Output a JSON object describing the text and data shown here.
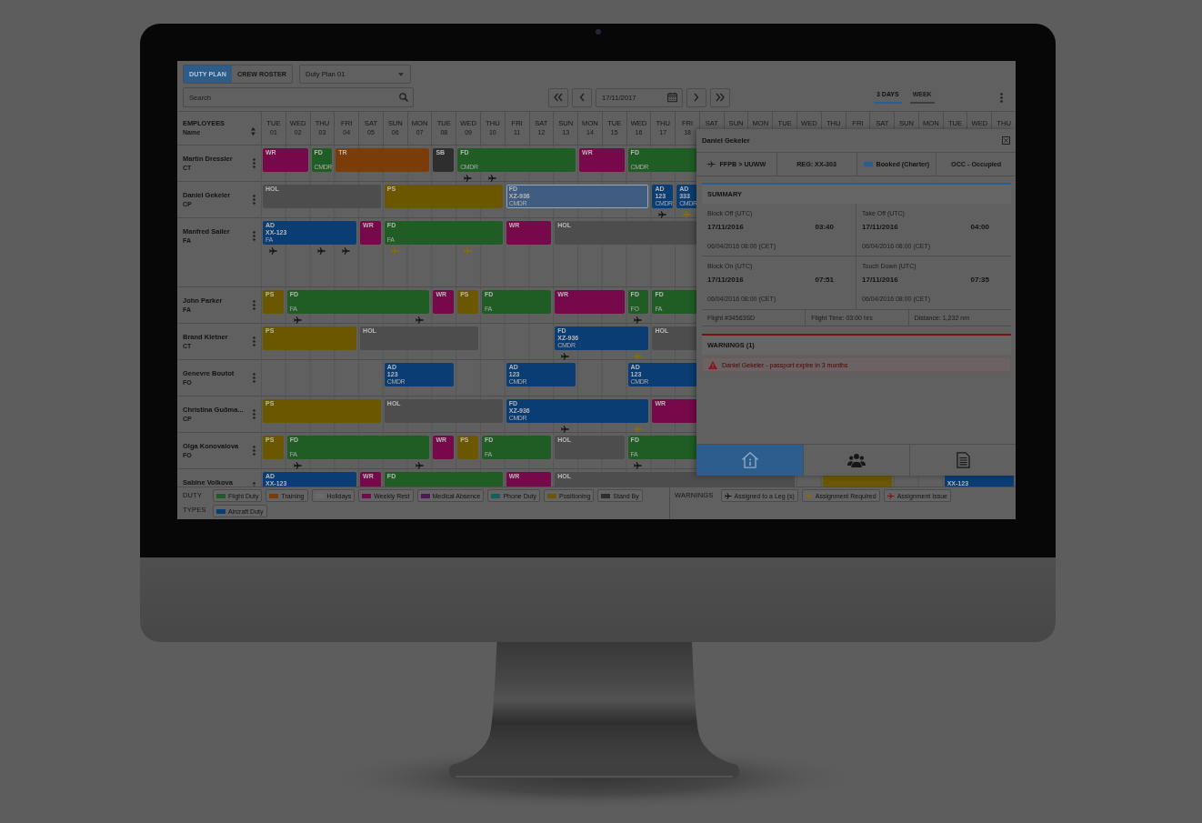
{
  "toolbar": {
    "view_switch": [
      {
        "label": "DUTY PLAN",
        "selected": true
      },
      {
        "label": "CREW ROSTER",
        "selected": false
      }
    ],
    "plan_select": {
      "value": "Duty Plan 01"
    },
    "search": {
      "placeholder": "Search"
    },
    "date_field": {
      "value": "17/11/2017"
    },
    "range_tabs": [
      {
        "label": "3 DAYS",
        "selected": true
      },
      {
        "label": "WEEK",
        "selected": false
      }
    ]
  },
  "schedule": {
    "employees_header": {
      "title": "EMPLOYEES",
      "subtitle": "Name"
    },
    "days": [
      {
        "day": "TUE",
        "date": "01"
      },
      {
        "day": "WED",
        "date": "02"
      },
      {
        "day": "THU",
        "date": "03"
      },
      {
        "day": "FRI",
        "date": "04"
      },
      {
        "day": "SAT",
        "date": "05"
      },
      {
        "day": "SUN",
        "date": "06"
      },
      {
        "day": "MON",
        "date": "07"
      },
      {
        "day": "TUE",
        "date": "08"
      },
      {
        "day": "WED",
        "date": "09"
      },
      {
        "day": "THU",
        "date": "10"
      },
      {
        "day": "FRI",
        "date": "11"
      },
      {
        "day": "SAT",
        "date": "12"
      },
      {
        "day": "SUN",
        "date": "13"
      },
      {
        "day": "MON",
        "date": "14"
      },
      {
        "day": "TUE",
        "date": "15"
      },
      {
        "day": "WED",
        "date": "16"
      },
      {
        "day": "THU",
        "date": "17"
      },
      {
        "day": "FRI",
        "date": "18"
      },
      {
        "day": "SAT"
      },
      {
        "day": "SUN"
      },
      {
        "day": "MON"
      },
      {
        "day": "TUE"
      },
      {
        "day": "WED"
      },
      {
        "day": "THU"
      },
      {
        "day": "FRI"
      },
      {
        "day": "SAT"
      },
      {
        "day": "SUN"
      },
      {
        "day": "MON"
      },
      {
        "day": "TUE"
      },
      {
        "day": "WED"
      },
      {
        "day": "THU"
      }
    ],
    "rows": [
      {
        "name": "Martin Dressler",
        "role": "CT",
        "expanded": false,
        "timeline": [
          {
            "kind": "duty",
            "code": "WR",
            "color": "#76094a",
            "selected": false
          },
          {
            "kind": "continued"
          },
          {
            "kind": "duty",
            "code": "FD",
            "role": "CMDR",
            "color": "#1f5d24",
            "selected": false
          },
          {
            "kind": "duty",
            "code": "TR",
            "color": "#7a3c08",
            "selected": false
          },
          {
            "kind": "continued"
          },
          {
            "kind": "continued"
          },
          {
            "kind": "continued"
          },
          {
            "kind": "duty",
            "code": "SB",
            "color": "#2e2e2e",
            "selected": false
          },
          {
            "kind": "duty",
            "code": "FD",
            "role": "CMDR",
            "color": "#1f5d24",
            "selected": false,
            "marker": {
              "color": "#121212"
            }
          },
          {
            "kind": "continued",
            "marker": {
              "color": "#121212"
            }
          },
          {
            "kind": "continued"
          },
          {
            "kind": "continued"
          },
          {
            "kind": "continued"
          },
          {
            "kind": "duty",
            "code": "WR",
            "color": "#76094a",
            "selected": false
          },
          {
            "kind": "continued"
          },
          {
            "kind": "duty",
            "code": "FD",
            "role": "CMDR",
            "color": "#1f5d24",
            "selected": false
          },
          {
            "kind": "continued"
          },
          {
            "kind": "continued"
          }
        ]
      },
      {
        "name": "Daniel Gekeler",
        "role": "CP",
        "expanded": false,
        "timeline": [
          {
            "kind": "duty",
            "code": "HOL",
            "color": "#4d4d4d",
            "selected": false
          },
          {
            "kind": "continued"
          },
          {
            "kind": "continued"
          },
          {
            "kind": "continued"
          },
          {
            "kind": "continued"
          },
          {
            "kind": "duty",
            "code": "PS",
            "color": "#6b5700",
            "selected": false
          },
          {
            "kind": "continued"
          },
          {
            "kind": "continued"
          },
          {
            "kind": "continued"
          },
          {
            "kind": "continued"
          },
          {
            "kind": "duty",
            "code": "FD",
            "detail": "XZ-936",
            "role": "CMDR",
            "color": "#405d80",
            "selected": true
          },
          {
            "kind": "continued"
          },
          {
            "kind": "continued"
          },
          {
            "kind": "continued"
          },
          {
            "kind": "continued"
          },
          {
            "kind": "continued"
          },
          {
            "kind": "duty",
            "code": "AD",
            "detail": "123",
            "role": "CMDR",
            "color": "#0a3d73",
            "selected": false,
            "marker": {
              "color": "#121212"
            }
          },
          {
            "kind": "duty",
            "code": "AD",
            "detail": "333",
            "role": "CMDR",
            "color": "#0a3d73",
            "selected": false,
            "marker": {
              "color": "#8a7000"
            }
          }
        ]
      },
      {
        "name": "Manfred Sailer",
        "role": "FA",
        "expanded": true,
        "timeline": [
          {
            "kind": "duty",
            "code": "AD",
            "detail": "XX-123",
            "role": "FA",
            "color": "#0a3d73",
            "selected": false,
            "marker": {
              "color": "#121212"
            }
          },
          {
            "kind": "continued"
          },
          {
            "kind": "continued",
            "marker": {
              "color": "#121212"
            }
          },
          {
            "kind": "continued",
            "marker": {
              "color": "#121212"
            }
          },
          {
            "kind": "duty",
            "code": "WR",
            "color": "#76094a",
            "selected": false
          },
          {
            "kind": "duty",
            "code": "FD",
            "role": "FA",
            "color": "#1f5d24",
            "selected": false,
            "marker": {
              "color": "#8a7000"
            }
          },
          {
            "kind": "continued"
          },
          {
            "kind": "continued"
          },
          {
            "kind": "continued",
            "marker": {
              "color": "#8a7000"
            }
          },
          {
            "kind": "continued"
          },
          {
            "kind": "duty",
            "code": "WR",
            "color": "#76094a",
            "selected": false
          },
          {
            "kind": "continued"
          },
          {
            "kind": "duty",
            "code": "HOL",
            "color": "#4d4d4d",
            "selected": false
          },
          {
            "kind": "continued"
          },
          {
            "kind": "continued"
          },
          {
            "kind": "continued"
          },
          {
            "kind": "continued"
          },
          {
            "kind": "continued"
          }
        ]
      },
      {
        "name": "John Parker",
        "role": "FA",
        "expanded": false,
        "timeline": [
          {
            "kind": "duty",
            "code": "PS",
            "color": "#6b5700",
            "selected": false
          },
          {
            "kind": "duty",
            "code": "FD",
            "role": "FA",
            "color": "#1f5d24",
            "selected": false,
            "marker": {
              "color": "#121212"
            }
          },
          {
            "kind": "continued"
          },
          {
            "kind": "continued"
          },
          {
            "kind": "continued"
          },
          {
            "kind": "continued"
          },
          {
            "kind": "continued",
            "marker": {
              "color": "#121212"
            }
          },
          {
            "kind": "duty",
            "code": "WR",
            "color": "#76094a",
            "selected": false
          },
          {
            "kind": "duty",
            "code": "PS",
            "color": "#6b5700",
            "selected": false
          },
          {
            "kind": "duty",
            "code": "FD",
            "role": "FA",
            "color": "#1f5d24",
            "selected": false
          },
          {
            "kind": "continued"
          },
          {
            "kind": "continued"
          },
          {
            "kind": "duty",
            "code": "WR",
            "color": "#76094a",
            "selected": false
          },
          {
            "kind": "continued"
          },
          {
            "kind": "continued"
          },
          {
            "kind": "duty",
            "code": "FD",
            "role": "FO",
            "color": "#1f5d24",
            "selected": false,
            "marker": {
              "color": "#121212"
            }
          },
          {
            "kind": "duty",
            "code": "FD",
            "role": "FA",
            "color": "#1f5d24",
            "selected": false
          },
          {
            "kind": "continued"
          }
        ]
      },
      {
        "name": "Brand Kletner",
        "role": "CT",
        "expanded": false,
        "timeline": [
          {
            "kind": "duty",
            "code": "PS",
            "color": "#6b5700",
            "selected": false
          },
          {
            "kind": "continued"
          },
          {
            "kind": "continued"
          },
          {
            "kind": "continued"
          },
          {
            "kind": "duty",
            "code": "HOL",
            "color": "#4d4d4d",
            "selected": false
          },
          {
            "kind": "continued"
          },
          {
            "kind": "continued"
          },
          {
            "kind": "continued"
          },
          {
            "kind": "continued"
          },
          {
            "kind": "free"
          },
          {
            "kind": "free"
          },
          {
            "kind": "free"
          },
          {
            "kind": "duty",
            "code": "FD",
            "detail": "XZ-936",
            "role": "CMDR",
            "color": "#0a3d73",
            "selected": false,
            "marker": {
              "color": "#121212"
            }
          },
          {
            "kind": "continued"
          },
          {
            "kind": "continued"
          },
          {
            "kind": "continued",
            "marker": {
              "color": "#8a7000"
            }
          },
          {
            "kind": "duty",
            "code": "HOL",
            "color": "#4d4d4d",
            "selected": false
          },
          {
            "kind": "continued"
          }
        ]
      },
      {
        "name": "Genevre Boutot",
        "role": "FO",
        "expanded": false,
        "timeline": [
          {
            "kind": "free"
          },
          {
            "kind": "free"
          },
          {
            "kind": "free"
          },
          {
            "kind": "free"
          },
          {
            "kind": "free"
          },
          {
            "kind": "duty",
            "code": "AD",
            "detail": "123",
            "role": "CMDR",
            "color": "#0a3d73",
            "selected": false
          },
          {
            "kind": "continued"
          },
          {
            "kind": "continued"
          },
          {
            "kind": "free"
          },
          {
            "kind": "free"
          },
          {
            "kind": "duty",
            "code": "AD",
            "detail": "123",
            "role": "CMDR",
            "color": "#0a3d73",
            "selected": false
          },
          {
            "kind": "continued"
          },
          {
            "kind": "continued"
          },
          {
            "kind": "free"
          },
          {
            "kind": "free"
          },
          {
            "kind": "duty",
            "code": "AD",
            "detail": "123",
            "role": "CMDR",
            "color": "#0a3d73",
            "selected": false
          },
          {
            "kind": "continued"
          },
          {
            "kind": "continued"
          }
        ]
      },
      {
        "name": "Christina Guðma...",
        "role": "CP",
        "expanded": false,
        "timeline": [
          {
            "kind": "duty",
            "code": "PS",
            "color": "#6b5700",
            "selected": false
          },
          {
            "kind": "continued"
          },
          {
            "kind": "continued"
          },
          {
            "kind": "continued"
          },
          {
            "kind": "continued"
          },
          {
            "kind": "duty",
            "code": "HOL",
            "color": "#4d4d4d",
            "selected": false
          },
          {
            "kind": "continued"
          },
          {
            "kind": "continued"
          },
          {
            "kind": "continued"
          },
          {
            "kind": "continued"
          },
          {
            "kind": "duty",
            "code": "FD",
            "detail": "XZ-936",
            "role": "CMDR",
            "color": "#0a3d73",
            "selected": false
          },
          {
            "kind": "continued"
          },
          {
            "kind": "continued",
            "marker": {
              "color": "#121212"
            }
          },
          {
            "kind": "continued"
          },
          {
            "kind": "continued"
          },
          {
            "kind": "continued",
            "marker": {
              "color": "#8a7000"
            }
          },
          {
            "kind": "duty",
            "code": "WR",
            "color": "#76094a",
            "selected": false
          },
          {
            "kind": "continued"
          }
        ]
      },
      {
        "name": "Olga Konovalova",
        "role": "FO",
        "expanded": false,
        "timeline": [
          {
            "kind": "duty",
            "code": "PS",
            "color": "#6b5700",
            "selected": false
          },
          {
            "kind": "duty",
            "code": "FD",
            "role": "FA",
            "color": "#1f5d24",
            "selected": false,
            "marker": {
              "color": "#121212"
            }
          },
          {
            "kind": "continued"
          },
          {
            "kind": "continued"
          },
          {
            "kind": "continued"
          },
          {
            "kind": "continued"
          },
          {
            "kind": "continued",
            "marker": {
              "color": "#121212"
            }
          },
          {
            "kind": "duty",
            "code": "WR",
            "color": "#76094a",
            "selected": false
          },
          {
            "kind": "duty",
            "code": "PS",
            "color": "#6b5700",
            "selected": false
          },
          {
            "kind": "duty",
            "code": "FD",
            "role": "FA",
            "color": "#1f5d24",
            "selected": false
          },
          {
            "kind": "continued"
          },
          {
            "kind": "continued"
          },
          {
            "kind": "duty",
            "code": "HOL",
            "color": "#4d4d4d",
            "selected": false
          },
          {
            "kind": "continued"
          },
          {
            "kind": "continued"
          },
          {
            "kind": "duty",
            "code": "FD",
            "role": "FA",
            "color": "#1f5d24",
            "selected": false,
            "marker": {
              "color": "#121212"
            }
          },
          {
            "kind": "continued"
          },
          {
            "kind": "continued"
          }
        ]
      },
      {
        "name": "Sabine Volkova",
        "expanded": false,
        "timeline": [
          {
            "kind": "duty",
            "code": "AD",
            "detail": "XX-123",
            "color": "#0a3d73",
            "selected": false
          },
          {
            "kind": "continued"
          },
          {
            "kind": "continued"
          },
          {
            "kind": "continued"
          },
          {
            "kind": "duty",
            "code": "WR",
            "color": "#76094a",
            "selected": false
          },
          {
            "kind": "duty",
            "code": "FD",
            "color": "#1f5d24",
            "selected": false
          },
          {
            "kind": "continued"
          },
          {
            "kind": "continued"
          },
          {
            "kind": "continued"
          },
          {
            "kind": "continued"
          },
          {
            "kind": "duty",
            "code": "WR",
            "color": "#76094a",
            "selected": false
          },
          {
            "kind": "continued"
          },
          {
            "kind": "duty",
            "code": "HOL",
            "color": "#4d4d4d",
            "selected": false
          },
          {
            "kind": "continued"
          },
          {
            "kind": "continued"
          },
          {
            "kind": "continued"
          },
          {
            "kind": "continued"
          },
          {
            "kind": "continued"
          },
          {
            "kind": "continued"
          },
          {
            "kind": "continued"
          },
          {
            "kind": "continued"
          },
          {
            "kind": "continued"
          },
          {
            "kind": "free"
          },
          {
            "kind": "duty",
            "color": "#6b5700",
            "selected": false
          },
          {
            "kind": "continued"
          },
          {
            "kind": "continued"
          },
          {
            "kind": "free"
          },
          {
            "kind": "free"
          },
          {
            "kind": "duty",
            "detail": "XX-123",
            "color": "#0a3d73",
            "selected": false
          },
          {
            "kind": "continued"
          },
          {
            "kind": "continued"
          }
        ]
      }
    ]
  },
  "detail_panel": {
    "title": "Daniel Gekeler",
    "route": "FFPB > UUWW",
    "registration": "REG: XX-303",
    "booking": "Booked (Charter)",
    "occupancy": "OCC - Occupied",
    "summary_title": "SUMMARY",
    "times": [
      {
        "label": "Block Off (UTC)",
        "date": "17/11/2016",
        "time": "03:40",
        "local": "06/04/2016 08:00 (CET)"
      },
      {
        "label": "Take Off (UTC)",
        "date": "17/11/2016",
        "time": "04:00",
        "local": "06/04/2016 08:00 (CET)"
      },
      {
        "label": "Block On (UTC)",
        "date": "17/11/2016",
        "time": "07:51",
        "local": "06/04/2016 08:00 (CET)"
      },
      {
        "label": "Touch Down (UTC)",
        "date": "17/11/2016",
        "time": "07:35",
        "local": "06/04/2016 08:00 (CET)"
      }
    ],
    "facts": [
      "Flight #34563SD",
      "Flight Time: 03:00 hrs",
      "Distance: 1,232 nm"
    ],
    "warnings_title": "WARNINGS (1)",
    "warnings": [
      "Daniel Gekeler - passport expire in 3 months"
    ],
    "tabs": [
      {
        "kind": "info",
        "selected": true
      },
      {
        "kind": "crew",
        "selected": false
      },
      {
        "kind": "report",
        "selected": false
      }
    ]
  },
  "legend": {
    "duty_title": "DUTY TYPES",
    "duty_types": [
      {
        "label": "Flight Duty",
        "color": "#1f5d24"
      },
      {
        "label": "Training",
        "color": "#7a3c08"
      },
      {
        "label": "Holidays",
        "color": "#6a6a6a"
      },
      {
        "label": "Weekly Rest",
        "color": "#76094a"
      },
      {
        "label": "Medical Absence",
        "color": "#4f1658"
      },
      {
        "label": "Phone Duty",
        "color": "#13605b"
      },
      {
        "label": "Positioning",
        "color": "#6b5700"
      },
      {
        "label": "Stand By",
        "color": "#2e2e2e"
      },
      {
        "label": "Aircraft Duty",
        "color": "#0a3d73"
      }
    ],
    "warnings_title": "WARNINGS",
    "warnings": [
      {
        "label": "Assigned to a Leg (s)",
        "color": "#121212"
      },
      {
        "label": "Assignment Required",
        "color": "#8a7000"
      },
      {
        "label": "Assignment Issue",
        "color": "#7d1010"
      }
    ]
  }
}
